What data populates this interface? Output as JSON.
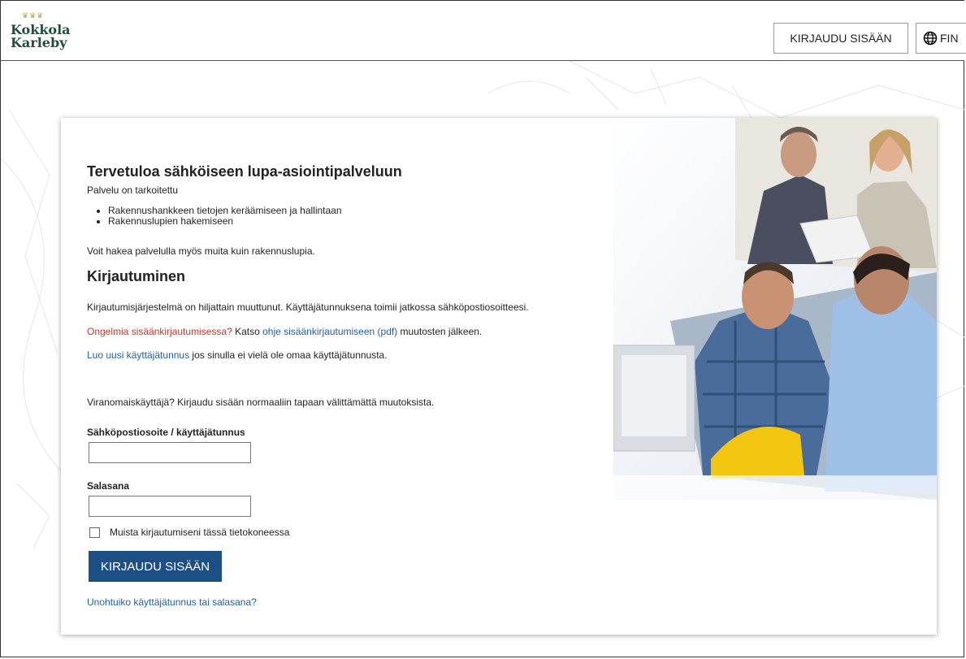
{
  "header": {
    "logo_line1": "Kokkola",
    "logo_line2": "Karleby",
    "login_button": "KIRJAUDU SISÄÄN",
    "language": "FIN"
  },
  "intro": {
    "title": "Tervetuloa sähköiseen lupa-asiointipalveluun",
    "subtitle": "Palvelu on tarkoitettu",
    "bullets": [
      "Rakennushankkeen tietojen keräämiseen ja hallintaan",
      "Rakennuslupien hakemiseen"
    ],
    "other_permits": "Voit hakea palvelulla myös muita kuin rakennuslupia."
  },
  "login": {
    "title": "Kirjautuminen",
    "notice": "Kirjautumisjärjestelmä on hiljattain muuttunut. Käyttäjätunnuksena toimii jatkossa sähköpostiosoitteesi.",
    "problems_red": "Ongelmia sisäänkirjautumisessa?",
    "problems_text1": " Katso ",
    "problems_link": "ohje sisäänkirjautumiseen (pdf)",
    "problems_text2": " muutosten jälkeen.",
    "create_link": "Luo uusi käyttäjätunnus",
    "create_text": " jos sinulla ei vielä ole omaa käyttäjätunnusta.",
    "authority_text": "Viranomaiskäyttäjä? Kirjaudu sisään normaaliin tapaan välittämättä muutoksista.",
    "email_label": "Sähköpostiosoite / käyttäjätunnus",
    "email_value": "",
    "password_label": "Salasana",
    "password_value": "",
    "remember_label": "Muista kirjautumiseni tässä tietokoneessa",
    "remember_checked": false,
    "submit_button": "KIRJAUDU SISÄÄN",
    "forgot_link": "Unohtuiko käyttäjätunnus tai salasana?"
  },
  "colors": {
    "primary_button": "#1b4f85",
    "link": "#1f5fa8",
    "warning_text": "#c0392b",
    "logo_green": "#1f4e3d"
  },
  "icons": [
    "globe-icon",
    "checkbox-icon"
  ]
}
